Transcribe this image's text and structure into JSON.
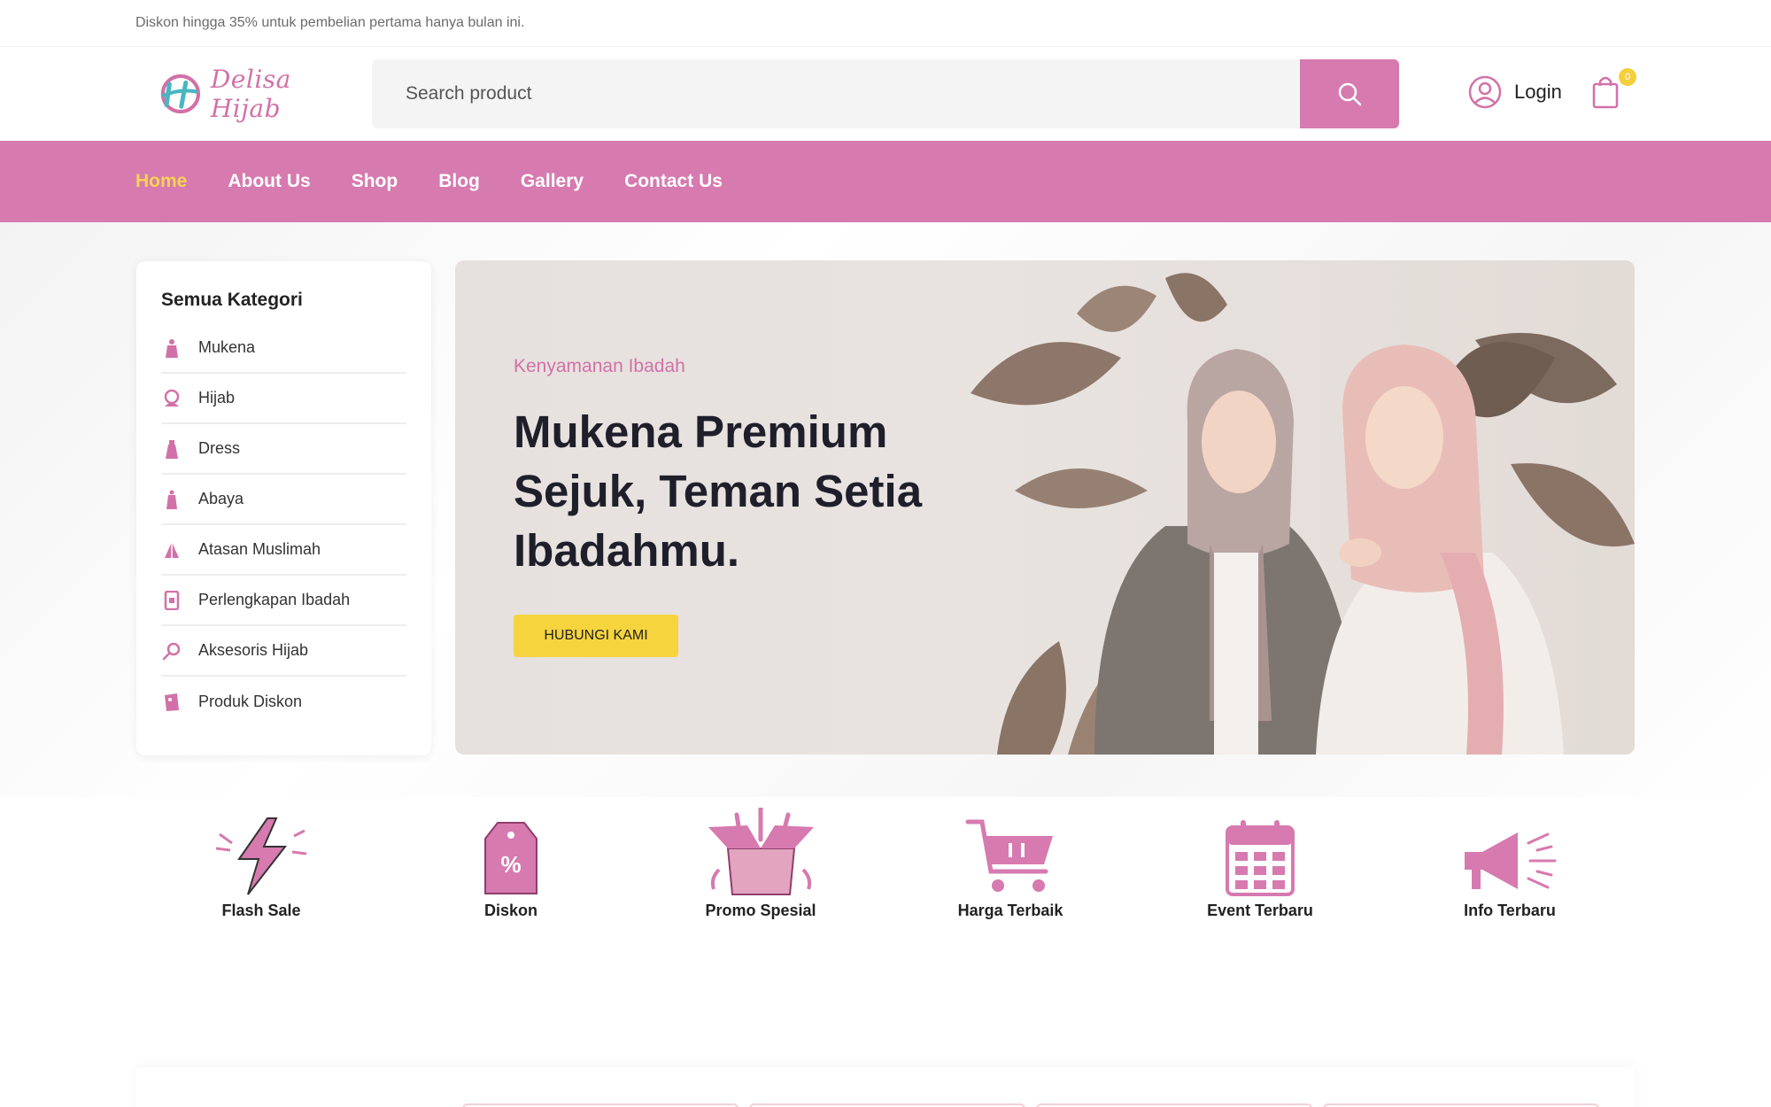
{
  "topbar": {
    "announcement": "Diskon hingga 35% untuk pembelian pertama hanya bulan ini."
  },
  "header": {
    "logo_text": "Delisa Hijab",
    "search_placeholder": "Search product",
    "login_label": "Login",
    "cart_count": "0"
  },
  "nav": {
    "items": [
      {
        "label": "Home",
        "active": true
      },
      {
        "label": "About Us"
      },
      {
        "label": "Shop"
      },
      {
        "label": "Blog"
      },
      {
        "label": "Gallery"
      },
      {
        "label": "Contact Us"
      }
    ]
  },
  "sidebar": {
    "title": "Semua Kategori",
    "items": [
      {
        "label": "Mukena",
        "icon": "mukena-icon"
      },
      {
        "label": "Hijab",
        "icon": "hijab-icon"
      },
      {
        "label": "Dress",
        "icon": "dress-icon"
      },
      {
        "label": "Abaya",
        "icon": "abaya-icon"
      },
      {
        "label": "Atasan Muslimah",
        "icon": "blouse-icon"
      },
      {
        "label": "Perlengkapan Ibadah",
        "icon": "prayer-book-icon"
      },
      {
        "label": "Aksesoris Hijab",
        "icon": "accessory-icon"
      },
      {
        "label": "Produk Diskon",
        "icon": "discount-tag-icon"
      }
    ]
  },
  "banner": {
    "kicker": "Kenyamanan Ibadah",
    "title": "Mukena Premium Sejuk, Teman Setia Ibadahmu.",
    "button_label": "HUBUNGI KAMI"
  },
  "features": [
    {
      "label": "Flash Sale",
      "icon": "lightning-icon"
    },
    {
      "label": "Diskon",
      "icon": "price-tag-icon"
    },
    {
      "label": "Promo Spesial",
      "icon": "gift-box-icon"
    },
    {
      "label": "Harga Terbaik",
      "icon": "shopping-cart-icon"
    },
    {
      "label": "Event Terbaru",
      "icon": "calendar-icon"
    },
    {
      "label": "Info Terbaru",
      "icon": "megaphone-icon"
    }
  ],
  "colors": {
    "brand_pink": "#d67aaf",
    "active_nav": "#f9d353",
    "button_yellow": "#f6d43e"
  }
}
